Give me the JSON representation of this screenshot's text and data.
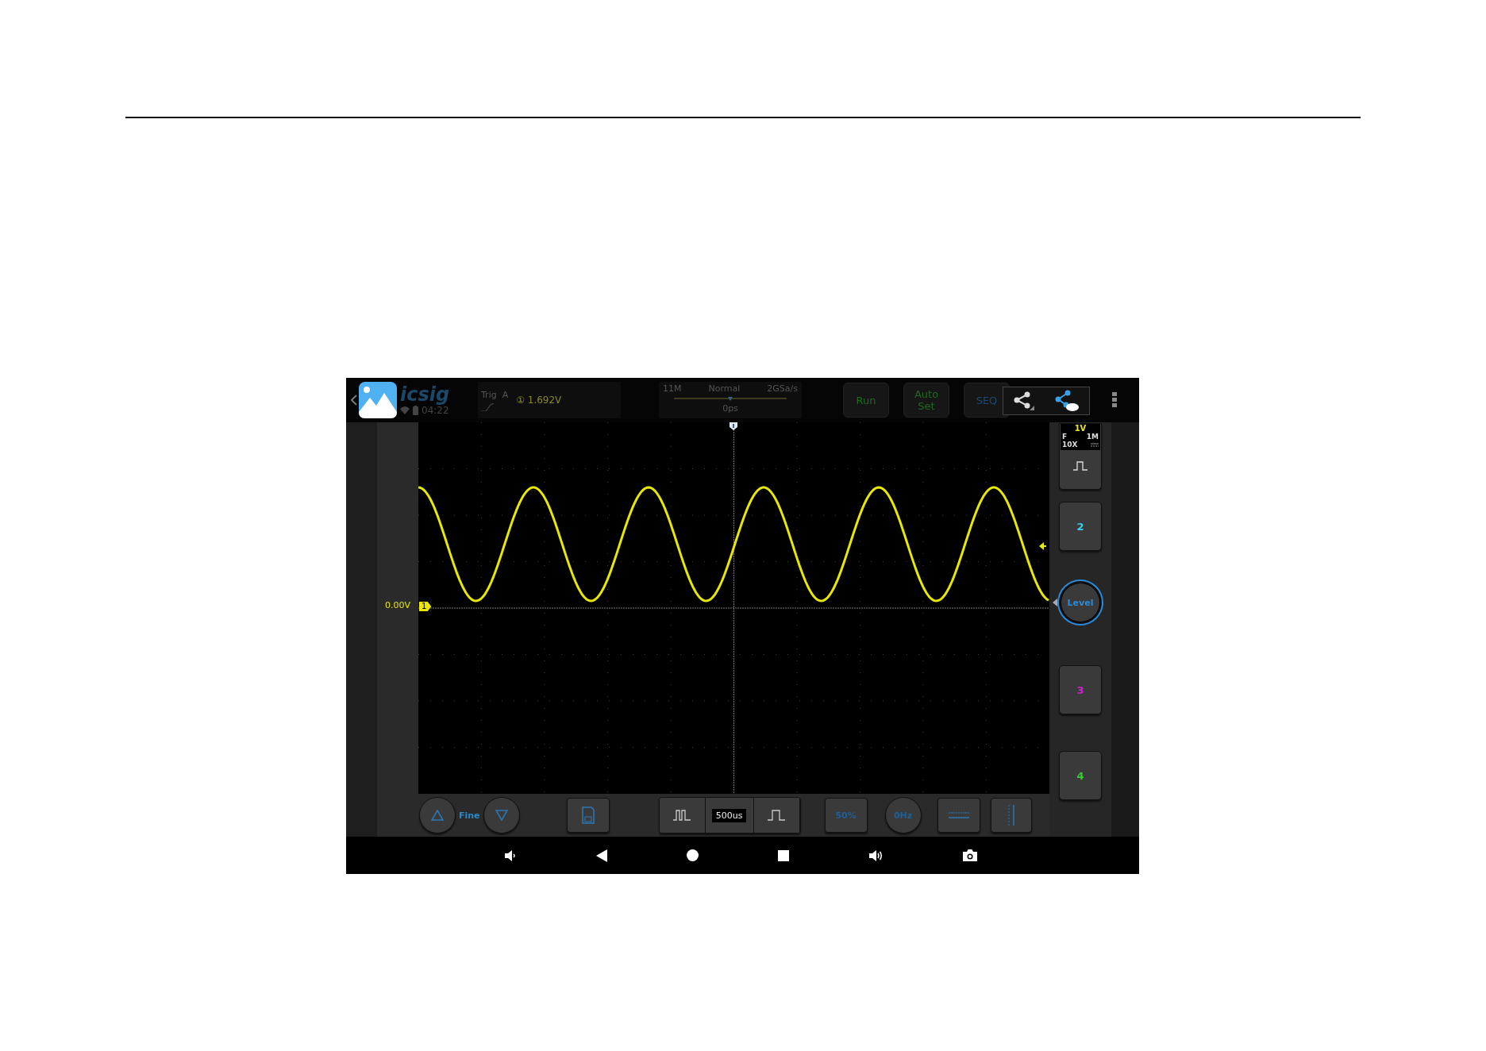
{
  "status_bar": {
    "logo": "icsig",
    "time": "04:22"
  },
  "trigger": {
    "label": "Trig",
    "source": "A",
    "channel": "①",
    "level": "1.692V"
  },
  "acquisition": {
    "memory": "11M",
    "mode": "Normal",
    "sample_rate": "2GSa/s",
    "delay": "0ps"
  },
  "top_buttons": [
    {
      "label": "Run",
      "kind": "run"
    },
    {
      "label": "Auto Set",
      "kind": "run"
    },
    {
      "label": "SEQ",
      "kind": "seq"
    }
  ],
  "channel_1": {
    "scale": "1V",
    "coupling": "F",
    "impedance": "1M",
    "probe": "10X",
    "color": "#e8e800"
  },
  "offset": {
    "reading": "0.00V",
    "marker": "1"
  },
  "side_buttons": [
    {
      "kind": "channel",
      "label": "2",
      "color": "#3ad0f0"
    },
    {
      "kind": "knob",
      "label": "Level"
    },
    {
      "kind": "channel",
      "label": "3",
      "color": "#d020d0"
    },
    {
      "kind": "channel",
      "label": "4",
      "color": "#30d030"
    }
  ],
  "bottom": {
    "fine": "Fine",
    "timebase": "500us",
    "percent": "50%",
    "frequency": "0Hz"
  }
}
